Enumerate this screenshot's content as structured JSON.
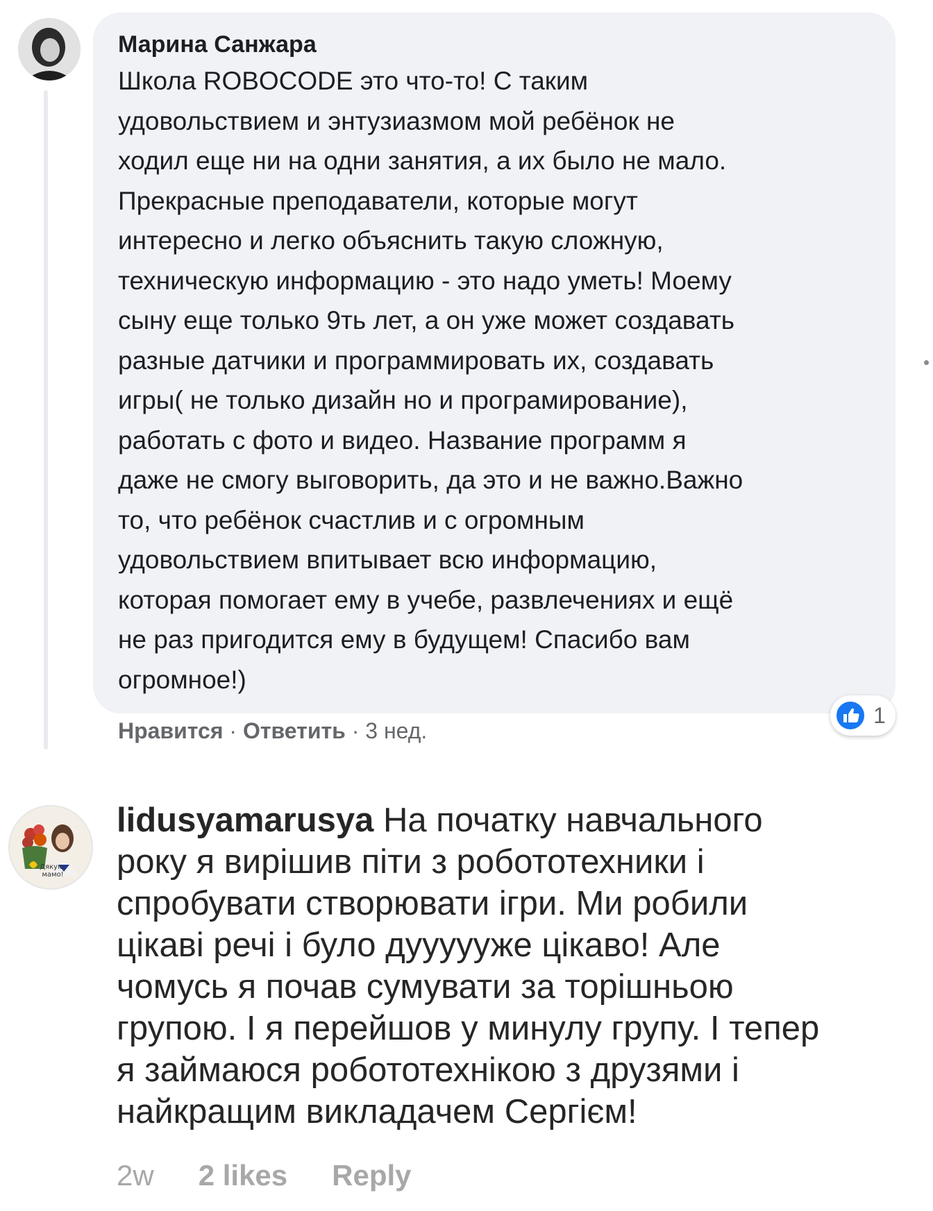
{
  "comments": [
    {
      "author": "Марина Санжара",
      "text": "Школа ROBOCODE это что-то! С таким\nудовольствием и энтузиазмом мой ребёнок не\nходил еще ни на одни занятия, а их было не мало.\nПрекрасные преподаватели, которые могут\nинтересно и легко объяснить такую сложную,\nтехническую информацию - это надо уметь! Моему\nсыну еще только 9ть лет, а он уже может создавать\nразные датчики и программировать их, создавать\nигры( не только дизайн но и програмирование),\nработать с фото и видео. Название программ я\nдаже не смогу выговорить, да это и не важно.Важно\nто, что ребёнок счастлив и с огромным\nудовольствием впитывает всю информацию,\nкоторая помогает ему в учебе, развлечениях и ещё\nне раз пригодится ему в будущем! Спасибо вам\nогромное!)",
      "like_label": "Нравится",
      "sep": "·",
      "reply_label": "Ответить",
      "time": "3 нед.",
      "reaction_count": "1",
      "reaction_icon": "like-icon",
      "reaction_color": "#1877f2"
    },
    {
      "username": "lidusyamarusya",
      "text": "На початку навчального\nроку я вирішив піти з робототехники і\nспробувати створювати ігри. Ми робили\nцікаві речі і було дуууууже цікаво! Але\nчомусь я почав сумувати за  торішньою\nгрупою. І я перейшов у минулу групу. І тепер\nя займаюся робототехнікою з друзями і\nнайкращим викладачем Сергієм!",
      "avatar_caption": "Дякую, мамо!",
      "time": "2w",
      "likes": "2 likes",
      "reply_label": "Reply"
    }
  ]
}
